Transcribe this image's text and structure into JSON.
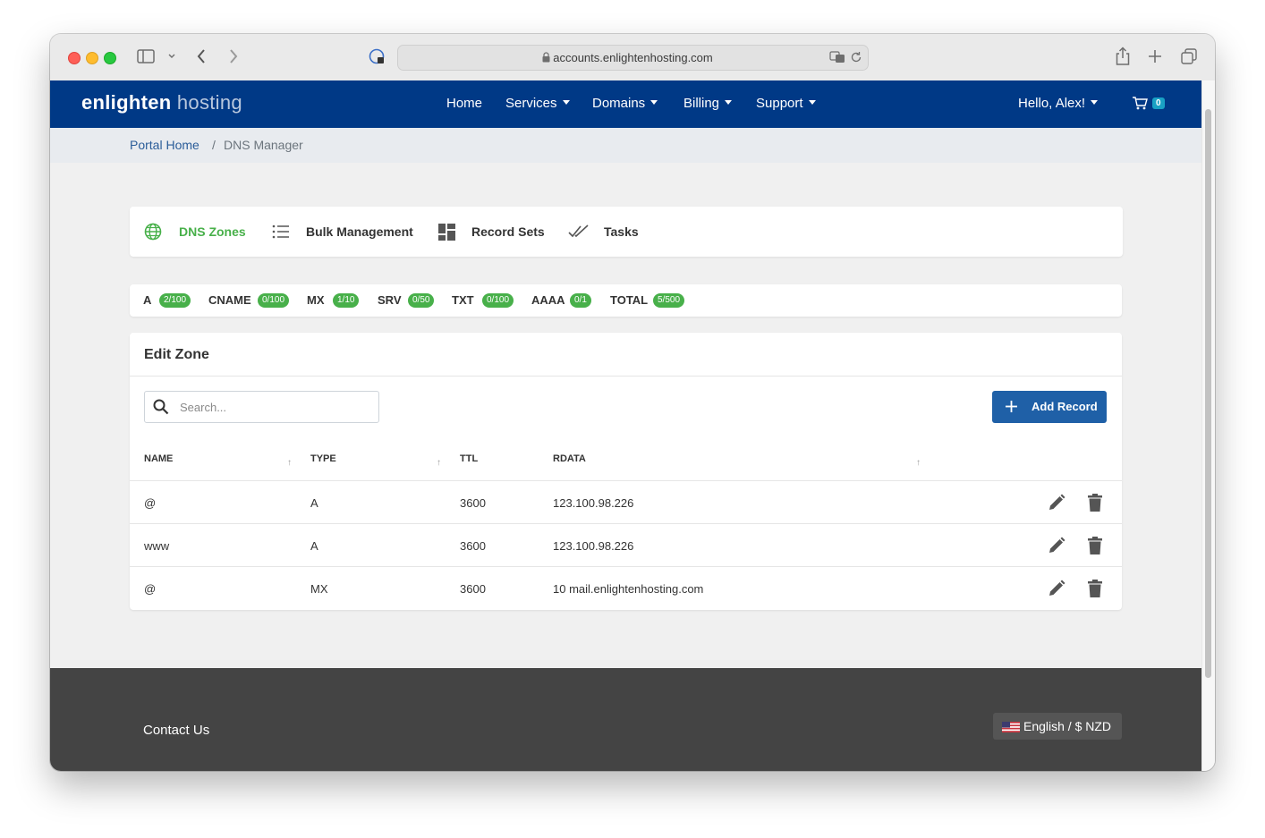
{
  "browser": {
    "url": "accounts.enlightenhosting.com"
  },
  "navbar": {
    "brand_bold": "enlighten",
    "brand_light": " hosting",
    "items": [
      {
        "label": "Home"
      },
      {
        "label": "Services"
      },
      {
        "label": "Domains"
      },
      {
        "label": "Billing"
      },
      {
        "label": "Support"
      }
    ],
    "user_greeting": "Hello, Alex!",
    "cart_count": "0"
  },
  "breadcrumb": {
    "home": "Portal Home",
    "separator": "/",
    "current": "DNS Manager"
  },
  "tabs": [
    {
      "label": "DNS Zones",
      "icon": "globe-icon",
      "active": true
    },
    {
      "label": "Bulk Management",
      "icon": "list-icon",
      "active": false
    },
    {
      "label": "Record Sets",
      "icon": "grid-icon",
      "active": false
    },
    {
      "label": "Tasks",
      "icon": "double-check-icon",
      "active": false
    }
  ],
  "quotas": [
    {
      "type": "A",
      "usage": "2/100"
    },
    {
      "type": "CNAME",
      "usage": "0/100"
    },
    {
      "type": "MX",
      "usage": "1/10"
    },
    {
      "type": "SRV",
      "usage": "0/50"
    },
    {
      "type": "TXT",
      "usage": "0/100"
    },
    {
      "type": "AAAA",
      "usage": "0/1"
    },
    {
      "type": "TOTAL",
      "usage": "5/500"
    }
  ],
  "zone": {
    "title": "Edit Zone",
    "search_placeholder": "Search...",
    "add_record_label": "Add Record",
    "columns": [
      "NAME",
      "TYPE",
      "TTL",
      "RDATA"
    ],
    "sort_glyph": "↑",
    "records": [
      {
        "name": "@",
        "type": "A",
        "ttl": "3600",
        "rdata": "123.100.98.226"
      },
      {
        "name": "www",
        "type": "A",
        "ttl": "3600",
        "rdata": "123.100.98.226"
      },
      {
        "name": "@",
        "type": "MX",
        "ttl": "3600",
        "rdata": "10 mail.enlightenhosting.com"
      }
    ]
  },
  "footer": {
    "contact_label": "Contact Us",
    "language_label": "English / $ NZD"
  },
  "colors": {
    "navbar": "#003986",
    "accent_green": "#48b04a",
    "primary_button": "#1f60a7",
    "footer": "#444444"
  }
}
